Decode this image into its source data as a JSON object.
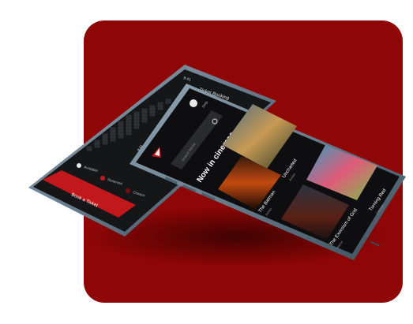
{
  "back_phone": {
    "status_time": "9:41",
    "header_title": "Ticket Booking",
    "legend": {
      "available": "Available",
      "reserved": "Reserved",
      "chosen": "Chosen"
    },
    "cta_label": "Book a Ticket",
    "colors": {
      "cta": "#c2181b",
      "screen": "#151618",
      "frame": "#6f8394"
    }
  },
  "front_phone": {
    "status_time": "9:41",
    "location": "Dnip",
    "search_placeholder": "Search Movie",
    "section_title": "Now in cinemas",
    "movies": [
      {
        "title": "Uncharted",
        "subtitle": "Action"
      },
      {
        "title": "The Batman",
        "subtitle": "Action"
      },
      {
        "title": "The Exorcism of God",
        "subtitle": "Horror"
      },
      {
        "title": "Turning Red",
        "subtitle": "Cartoon"
      }
    ],
    "colors": {
      "screen": "#0e0e10",
      "frame": "#5f7585",
      "accent": "#c2181b"
    }
  },
  "background": {
    "color": "#8e0606"
  },
  "icons": [
    "search-icon",
    "location-pin-icon",
    "profile-avatar-icon",
    "app-logo-icon"
  ]
}
